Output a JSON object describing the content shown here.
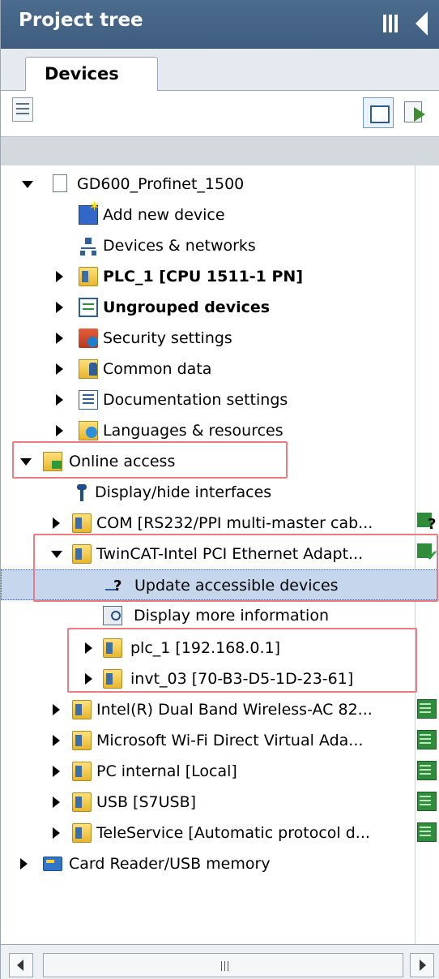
{
  "panel": {
    "title": "Project tree"
  },
  "tabs": [
    {
      "label": "Devices"
    }
  ],
  "tree": [
    {
      "label": "GD600_Profinet_1500",
      "icon": "project-doc-icon",
      "expanded": true
    },
    {
      "label": "Add new device",
      "icon": "add-device-icon"
    },
    {
      "label": "Devices & networks",
      "icon": "network-icon"
    },
    {
      "label": "PLC_1 [CPU 1511-1 PN]",
      "icon": "plc-icon",
      "bold": true
    },
    {
      "label": "Ungrouped devices",
      "icon": "ungrouped-devices-icon",
      "bold": true
    },
    {
      "label": "Security settings",
      "icon": "security-icon"
    },
    {
      "label": "Common data",
      "icon": "common-data-icon"
    },
    {
      "label": "Documentation settings",
      "icon": "documentation-icon"
    },
    {
      "label": "Languages & resources",
      "icon": "languages-icon"
    },
    {
      "label": "Online access",
      "icon": "online-access-icon",
      "expanded": true
    },
    {
      "label": "Display/hide interfaces",
      "icon": "interface-icon"
    },
    {
      "label": "COM [RS232/PPI multi-master cab...",
      "icon": "folder-icon",
      "status": "unknown"
    },
    {
      "label": "TwinCAT-Intel PCI Ethernet Adapt...",
      "icon": "folder-icon",
      "expanded": true,
      "status": "connected"
    },
    {
      "label": "Update accessible devices",
      "icon": "update-devices-icon",
      "selected": true
    },
    {
      "label": "Display more information",
      "icon": "info-icon"
    },
    {
      "label": "plc_1 [192.168.0.1]",
      "icon": "plc-icon"
    },
    {
      "label": "invt_03 [70-B3-D5-1D-23-61]",
      "icon": "plc-icon"
    },
    {
      "label": "Intel(R) Dual Band Wireless-AC 82...",
      "icon": "folder-icon",
      "status": "online"
    },
    {
      "label": "Microsoft Wi-Fi Direct Virtual Ada...",
      "icon": "folder-icon",
      "status": "online"
    },
    {
      "label": "PC internal [Local]",
      "icon": "folder-icon",
      "status": "online"
    },
    {
      "label": "USB [S7USB]",
      "icon": "folder-icon",
      "status": "online"
    },
    {
      "label": "TeleService [Automatic protocol d...",
      "icon": "folder-icon",
      "status": "online"
    },
    {
      "label": "Card Reader/USB memory",
      "icon": "card-reader-icon"
    }
  ],
  "colors": {
    "titlebar": "#4c6c8e",
    "selection": "#c6d6ec",
    "highlight": "#f07a82"
  }
}
